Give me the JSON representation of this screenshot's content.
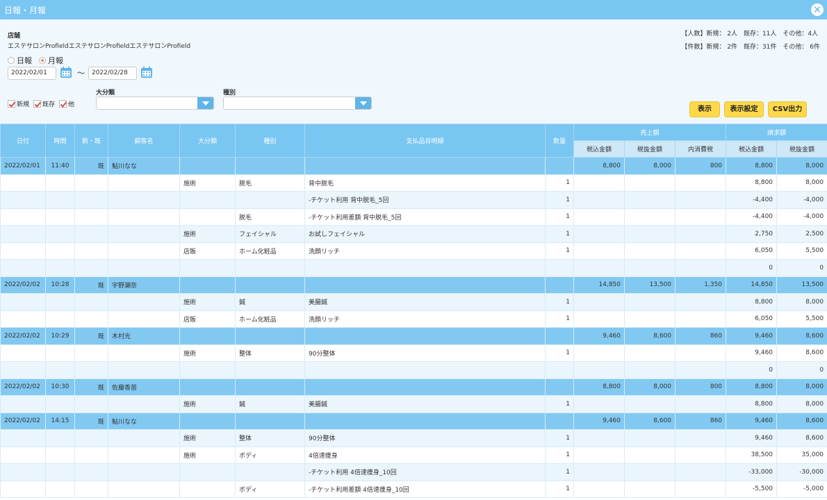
{
  "window": {
    "title": "日報・月報",
    "close_icon": "close-icon"
  },
  "store": {
    "label": "店舗",
    "name": "エステサロンProfieldエステサロンProfieldエステサロンProfield"
  },
  "stats": {
    "people": "【人数】新規： 2人　既存：11人　その他：4人",
    "cases": "【件数】新規： 2件　既存：31件　その他： 6件"
  },
  "period": {
    "daily": "日報",
    "monthly": "月報",
    "selected": "monthly"
  },
  "dates": {
    "from": "2022/02/01",
    "to": "2022/02/28",
    "separator": "～"
  },
  "filters": {
    "checkboxes": [
      {
        "label": "新規",
        "checked": true
      },
      {
        "label": "既存",
        "checked": true
      },
      {
        "label": "他",
        "checked": true
      }
    ],
    "major_category_label": "大分類",
    "type_label": "種別",
    "major_category_value": "",
    "type_value": ""
  },
  "buttons": {
    "show": "表示",
    "show_settings": "表示設定",
    "csv": "CSV出力"
  },
  "colors": {
    "header": "#79c6f2",
    "group_row": "#82c9f2",
    "alt_row": "#eaf5fc",
    "button": "#ffd94a"
  },
  "table": {
    "headers": {
      "date": "日付",
      "time": "時間",
      "new_existing": "新・既",
      "customer": "顧客名",
      "major_category": "大分類",
      "type": "種別",
      "item": "支払品目明細",
      "quantity": "数量",
      "sales": "売上額",
      "billing": "請求額"
    },
    "subheaders": {
      "sales_incl": "税込金額",
      "sales_excl": "税抜金額",
      "sales_tax": "内消費税",
      "bill_incl": "税込金額",
      "bill_excl": "税抜金額"
    },
    "rows": [
      {
        "kind": "group",
        "cells": [
          "2022/02/01",
          "11:40",
          "既",
          "鮎川なな",
          "",
          "",
          "",
          "",
          "8,800",
          "8,000",
          "800",
          "8,800",
          "8,000"
        ]
      },
      {
        "kind": "plain",
        "cells": [
          "",
          "",
          "",
          "",
          "施術",
          "脱毛",
          "背中脱毛",
          "1",
          "",
          "",
          "",
          "8,800",
          "8,000"
        ]
      },
      {
        "kind": "alt",
        "cells": [
          "",
          "",
          "",
          "",
          "",
          "",
          "-チケット利用 背中脱毛_5回",
          "1",
          "",
          "",
          "",
          "-4,400",
          "-4,000"
        ]
      },
      {
        "kind": "plain",
        "cells": [
          "",
          "",
          "",
          "",
          "",
          "脱毛",
          "-チケット利用差額 背中脱毛_5回",
          "1",
          "",
          "",
          "",
          "-4,400",
          "-4,000"
        ]
      },
      {
        "kind": "alt",
        "cells": [
          "",
          "",
          "",
          "",
          "施術",
          "フェイシャル",
          "お試しフェイシャル",
          "1",
          "",
          "",
          "",
          "2,750",
          "2,500"
        ]
      },
      {
        "kind": "plain",
        "cells": [
          "",
          "",
          "",
          "",
          "店販",
          "ホーム化粧品",
          "洗顔リッチ",
          "1",
          "",
          "",
          "",
          "6,050",
          "5,500"
        ]
      },
      {
        "kind": "alt",
        "cells": [
          "",
          "",
          "",
          "",
          "",
          "",
          "",
          "",
          "",
          "",
          "",
          "0",
          "0"
        ]
      },
      {
        "kind": "group",
        "cells": [
          "2022/02/02",
          "10:28",
          "既",
          "宇野瀬奈",
          "",
          "",
          "",
          "",
          "14,850",
          "13,500",
          "1,350",
          "14,850",
          "13,500"
        ]
      },
      {
        "kind": "alt",
        "cells": [
          "",
          "",
          "",
          "",
          "施術",
          "鍼",
          "美腸鍼",
          "1",
          "",
          "",
          "",
          "8,800",
          "8,000"
        ]
      },
      {
        "kind": "plain",
        "cells": [
          "",
          "",
          "",
          "",
          "店販",
          "ホーム化粧品",
          "洗顔リッチ",
          "1",
          "",
          "",
          "",
          "6,050",
          "5,500"
        ]
      },
      {
        "kind": "group",
        "cells": [
          "2022/02/02",
          "10:29",
          "既",
          "木村光",
          "",
          "",
          "",
          "",
          "9,460",
          "8,600",
          "860",
          "9,460",
          "8,600"
        ]
      },
      {
        "kind": "plain",
        "cells": [
          "",
          "",
          "",
          "",
          "施術",
          "整体",
          "90分整体",
          "1",
          "",
          "",
          "",
          "9,460",
          "8,600"
        ]
      },
      {
        "kind": "alt",
        "cells": [
          "",
          "",
          "",
          "",
          "",
          "",
          "",
          "",
          "",
          "",
          "",
          "0",
          "0"
        ]
      },
      {
        "kind": "group",
        "cells": [
          "2022/02/02",
          "10:30",
          "既",
          "佐藤香苗",
          "",
          "",
          "",
          "",
          "8,800",
          "8,000",
          "800",
          "8,800",
          "8,000"
        ]
      },
      {
        "kind": "alt",
        "cells": [
          "",
          "",
          "",
          "",
          "施術",
          "鍼",
          "美腸鍼",
          "1",
          "",
          "",
          "",
          "8,800",
          "8,000"
        ]
      },
      {
        "kind": "group",
        "cells": [
          "2022/02/02",
          "14:15",
          "既",
          "鮎川なな",
          "",
          "",
          "",
          "",
          "9,460",
          "8,600",
          "860",
          "9,460",
          "8,600"
        ]
      },
      {
        "kind": "alt",
        "cells": [
          "",
          "",
          "",
          "",
          "施術",
          "整体",
          "90分整体",
          "1",
          "",
          "",
          "",
          "9,460",
          "8,600"
        ]
      },
      {
        "kind": "plain",
        "cells": [
          "",
          "",
          "",
          "",
          "施術",
          "ボディ",
          "4倍速痩身",
          "1",
          "",
          "",
          "",
          "38,500",
          "35,000"
        ]
      },
      {
        "kind": "alt",
        "cells": [
          "",
          "",
          "",
          "",
          "",
          "",
          "-チケット利用 4倍速痩身_10回",
          "1",
          "",
          "",
          "",
          "-33,000",
          "-30,000"
        ]
      },
      {
        "kind": "plain",
        "cells": [
          "",
          "",
          "",
          "",
          "",
          "ボディ",
          "-チケット利用差額 4倍速痩身_10回",
          "1",
          "",
          "",
          "",
          "-5,500",
          "-5,000"
        ]
      }
    ]
  }
}
